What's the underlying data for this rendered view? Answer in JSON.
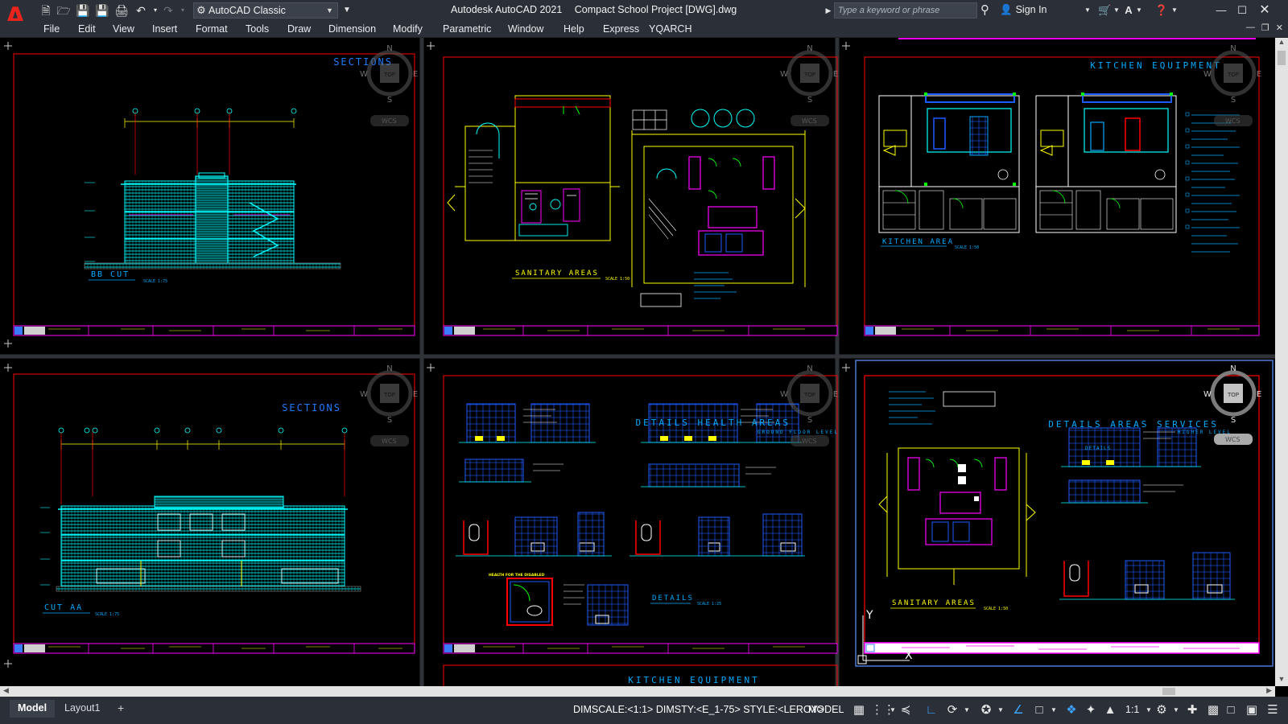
{
  "app": {
    "logo_letter": "A",
    "workspace": "AutoCAD Classic",
    "title": "Autodesk AutoCAD 2021",
    "document": "Compact School Project [DWG].dwg",
    "search_placeholder": "Type a keyword or phrase",
    "sign_in": "Sign In"
  },
  "quick_access": [
    "new-icon",
    "open-icon",
    "save-icon",
    "save-as-icon",
    "print-icon",
    "undo-icon",
    "redo-icon"
  ],
  "menus": [
    "File",
    "Edit",
    "View",
    "Insert",
    "Format",
    "Tools",
    "Draw",
    "Dimension",
    "Modify",
    "Parametric",
    "Window",
    "Help",
    "Express",
    "YQARCH"
  ],
  "viewports": [
    {
      "id": "vp1",
      "titles": [
        "SECTIONS"
      ],
      "caption": "BB CUT",
      "scale": "SCALE 1:75"
    },
    {
      "id": "vp2",
      "titles": [],
      "caption": "SANITARY AREAS",
      "scale": "SCALE 1:50"
    },
    {
      "id": "vp3",
      "titles": [
        "KITCHEN EQUIPMENT"
      ],
      "caption": "KITCHEN AREA",
      "scale": "SCALE 1:50"
    },
    {
      "id": "vp4",
      "titles": [
        "SECTIONS"
      ],
      "caption": "CUT AA",
      "scale": "SCALE 1:75"
    },
    {
      "id": "vp5",
      "titles": [
        "DETAILS HEALTH AREAS",
        "GROUND FLOOR LEVEL"
      ],
      "caption": "DETAILS",
      "sub_caption": "HEALTH FOR THE DISABLED",
      "scale": "SCALE 1:25"
    },
    {
      "id": "vp6",
      "titles": [
        "DETAILS AREAS SERVICES",
        "HIGHER LEVEL"
      ],
      "caption": "SANITARY AREAS",
      "sub_caption": "DETAILS",
      "scale": "SCALE 1:50"
    }
  ],
  "viewcube": {
    "north": "N",
    "south": "S",
    "east": "E",
    "west": "W",
    "top": "TOP",
    "wcs": "WCS"
  },
  "partial_label": "KITCHEN EQUIPMENT",
  "ucs": {
    "y": "Y",
    "x": "X"
  },
  "tabs": {
    "model": "Model",
    "layout1": "Layout1",
    "add": "+"
  },
  "status": {
    "info": "DIMSCALE:<1:1> DIMSTY:<E_1-75> STYLE:<LEROY>",
    "model": "MODEL",
    "scale": "1:1"
  },
  "colors": {
    "cyan": "#00ffff",
    "red": "#ff0000",
    "yellow": "#ffff00",
    "magenta": "#ff00ff",
    "green": "#00ff00",
    "blue": "#1e5bff",
    "frame_red": "#ff0000",
    "title_block_magenta": "#ff00ff",
    "chrome": "#2b3038"
  }
}
